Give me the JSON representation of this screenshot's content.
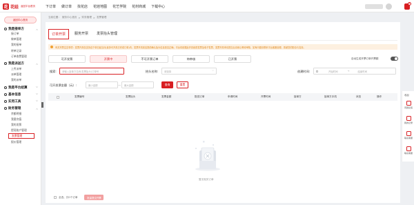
{
  "brand": {
    "mark": "花",
    "name": "花娃",
    "subtitle": "返回平台首页"
  },
  "topnav": [
    "下订单",
    "做订单",
    "找花店",
    "花娃地图",
    "花艺学院",
    "花材商城",
    "下载中心"
  ],
  "header": {
    "notification_count": "6"
  },
  "sidebar": {
    "home_button": "返回中心首页",
    "groups": [
      {
        "label": "我是接单方",
        "items": [
          "接订单",
          "做单管理",
          "我的接单",
          "转单记录",
          "订单收费管理"
        ]
      },
      {
        "label": "我是派送方",
        "items": [
          "上传派单",
          "派单管理",
          "我的派单"
        ]
      },
      {
        "label": "我是平台结算",
        "items": []
      },
      {
        "label": "基本信息",
        "items": []
      },
      {
        "label": "实用工具",
        "items": []
      },
      {
        "label": "财务管理",
        "items": [
          "余额明细",
          "我要充值",
          "我的发票",
          "提现账户管理",
          "发票管理",
          "报价管理"
        ]
      }
    ],
    "active_item": "发票管理"
  },
  "breadcrumb": [
    "当前位置：",
    "服务中心首页",
    ">",
    "财务管理",
    ">",
    "发票管理"
  ],
  "tabs": [
    "订单开票",
    "服务开票",
    "发票抬头管理"
  ],
  "active_tab": "订单开票",
  "notice": "有关开票注意事项：发票开具仅支持自下单日起当月(最多可开具已完成订单)内，发票开具前应提前确认抬头信息是否正确，平台将依据此开具纸质发票及电子发票，发票开具申请提交后请耐心等待审核，如有问题请联系平台客服处理，感谢您的配合与支持。",
  "status_tabs": [
    "可开发票",
    "开票中",
    "不可开票订单",
    "待审核",
    "已开票"
  ],
  "active_status_tab": "开票中",
  "auto_label": "自动生成开票订单开票额",
  "filters": {
    "search_label": "搜索:",
    "search_placeholder": "请输入接单方名称/发票抬头/订单号",
    "title_label": "抬头名称:",
    "title_placeholder": "请选择",
    "time_label": "创建时间:",
    "start_placeholder": "开始时间",
    "to": "→",
    "end_placeholder": "结束时间",
    "amount_label": "可开发票金额（元）:",
    "min_placeholder": "最小金额",
    "dash": "—",
    "max_placeholder": "最大金额",
    "search_button": "查询",
    "reset_button": "重置"
  },
  "table": {
    "columns": [
      "发票编号",
      "发票抬头",
      "发票金额",
      "配送订单",
      "申请时间",
      "开票时间",
      "接单方",
      "接单方手机",
      "状态",
      "操作"
    ]
  },
  "empty_text": "暂无相关订单",
  "footer": {
    "select_all": "全选，共0个订单",
    "batch_button": "批量提交开票"
  },
  "rightbar": {
    "close": "收起",
    "items": [
      {
        "label": "问题反馈",
        "icon": "edit-icon"
      },
      {
        "label": "我的记录",
        "icon": "record-icon"
      },
      {
        "label": "联系客服",
        "icon": "headset-icon"
      },
      {
        "label": "联系客服",
        "icon": "kefu-icon"
      }
    ]
  },
  "colors": {
    "accent": "#d81e22",
    "notice_bg": "#fdf0e0",
    "notice_text": "#e08a1e"
  }
}
